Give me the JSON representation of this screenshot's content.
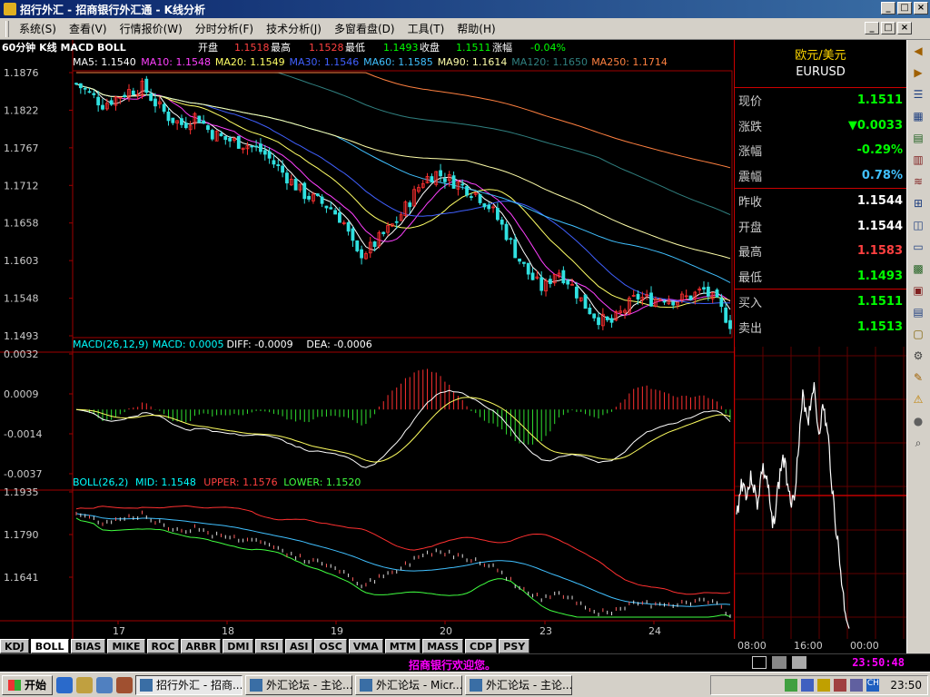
{
  "window": {
    "title": "招行外汇 - 招商银行外汇通 - K线分析",
    "buttons": [
      "_",
      "□",
      "×"
    ]
  },
  "menu": [
    "系统(S)",
    "查看(V)",
    "行情报价(W)",
    "分时分析(F)",
    "技术分析(J)",
    "多窗看盘(D)",
    "工具(T)",
    "帮助(H)"
  ],
  "chart_header": {
    "period": "60分钟 K线 MACD BOLL",
    "open_label": "开盘",
    "open": "1.1518",
    "high_label": "最高",
    "high": "1.1528",
    "low_label": "最低",
    "low": "1.1493",
    "close_label": "收盘",
    "close": "1.1511",
    "change_label": "涨幅",
    "change": "-0.04%"
  },
  "ma_legend": [
    {
      "text": "MA5: 1.1540",
      "color": "#ffffff"
    },
    {
      "text": "MA10: 1.1548",
      "color": "#ff40ff"
    },
    {
      "text": "MA20: 1.1549",
      "color": "#ffff66"
    },
    {
      "text": "MA30: 1.1546",
      "color": "#4060ff"
    },
    {
      "text": "MA60: 1.1585",
      "color": "#40c0ff"
    },
    {
      "text": "MA90: 1.1614",
      "color": "#ffffaa"
    },
    {
      "text": "MA120: 1.1650",
      "color": "#308080"
    },
    {
      "text": "MA250: 1.1714",
      "color": "#ff8040"
    }
  ],
  "macd_legend": [
    {
      "text": "MACD(26,12,9)",
      "color": "#00ffff"
    },
    {
      "text": "MACD: 0.0005",
      "color": "#00ffff"
    },
    {
      "text": "DIFF: -0.0009",
      "color": "#ffffff"
    },
    {
      "text": "DEA: -0.0006",
      "color": "#ffffff"
    }
  ],
  "boll_legend": [
    {
      "text": "BOLL(26,2)",
      "color": "#00ffff"
    },
    {
      "text": "MID: 1.1548",
      "color": "#00ffff"
    },
    {
      "text": "UPPER: 1.1576",
      "color": "#ff4040"
    },
    {
      "text": "LOWER: 1.1520",
      "color": "#40ff40"
    }
  ],
  "chart_data": [
    {
      "type": "candlestick",
      "title": "K线",
      "ylim": [
        1.1493,
        1.1876
      ],
      "y_ticks": [
        "1.1876",
        "1.1822",
        "1.1767",
        "1.1712",
        "1.1658",
        "1.1603",
        "1.1548",
        "1.1493"
      ],
      "x_ticks": [
        "17",
        "18",
        "19",
        "20",
        "23",
        "24"
      ],
      "close_path": [
        1.186,
        1.1845,
        1.183,
        1.184,
        1.185,
        1.1855,
        1.183,
        1.181,
        1.18,
        1.1815,
        1.179,
        1.178,
        1.1775,
        1.177,
        1.176,
        1.174,
        1.172,
        1.17,
        1.169,
        1.168,
        1.166,
        1.161,
        1.162,
        1.164,
        1.166,
        1.169,
        1.172,
        1.173,
        1.172,
        1.171,
        1.17,
        1.168,
        1.165,
        1.161,
        1.158,
        1.156,
        1.159,
        1.157,
        1.154,
        1.152,
        1.151,
        1.153,
        1.155,
        1.1545,
        1.155,
        1.1545,
        1.155,
        1.156,
        1.154,
        1.1511
      ]
    },
    {
      "type": "bar",
      "title": "MACD(26,12,9)",
      "ylim": [
        -0.0037,
        0.0032
      ],
      "y_ticks": [
        "0.0032",
        "0.0009",
        "-0.0014",
        "-0.0037"
      ]
    },
    {
      "type": "line",
      "title": "BOLL(26,2)",
      "ylim": [
        1.15,
        1.1935
      ],
      "y_ticks": [
        "1.1935",
        "1.1790",
        "1.1641"
      ]
    },
    {
      "type": "line",
      "title": "EURUSD 分时",
      "x_ticks": [
        "08:00",
        "16:00",
        "00:00"
      ]
    }
  ],
  "quote": {
    "title": "欧元/美元",
    "symbol": "EURUSD",
    "rows": [
      {
        "label": "现价",
        "value": "1.1511",
        "color": "#00ff00"
      },
      {
        "label": "涨跌",
        "value": "▼0.0033",
        "color": "#00ff00"
      },
      {
        "label": "涨幅",
        "value": "-0.29%",
        "color": "#00ff00"
      },
      {
        "label": "震幅",
        "value": "0.78%",
        "color": "#40c0ff"
      },
      {
        "label": "昨收",
        "value": "1.1544",
        "color": "#ffffff"
      },
      {
        "label": "开盘",
        "value": "1.1544",
        "color": "#ffffff"
      },
      {
        "label": "最高",
        "value": "1.1583",
        "color": "#ff4040"
      },
      {
        "label": "最低",
        "value": "1.1493",
        "color": "#00ff00"
      },
      {
        "label": "买入",
        "value": "1.1511",
        "color": "#00ff00"
      },
      {
        "label": "卖出",
        "value": "1.1513",
        "color": "#00ff00"
      }
    ]
  },
  "tabs": [
    "KDJ",
    "BOLL",
    "BIAS",
    "MIKE",
    "ROC",
    "ARBR",
    "DMI",
    "RSI",
    "ASI",
    "OSC",
    "VMA",
    "MTM",
    "MASS",
    "CDP",
    "PSY"
  ],
  "active_tab": "BOLL",
  "status": {
    "message": "招商银行欢迎您。",
    "clock": "23:50:48"
  },
  "taskbar": {
    "start": "开始",
    "tasks": [
      "招行外汇 - 招商...",
      "外汇论坛 - 主论...",
      "外汇论坛 - Micr...",
      "外汇论坛 - 主论..."
    ],
    "active_task": 0,
    "clock": "23:50"
  }
}
